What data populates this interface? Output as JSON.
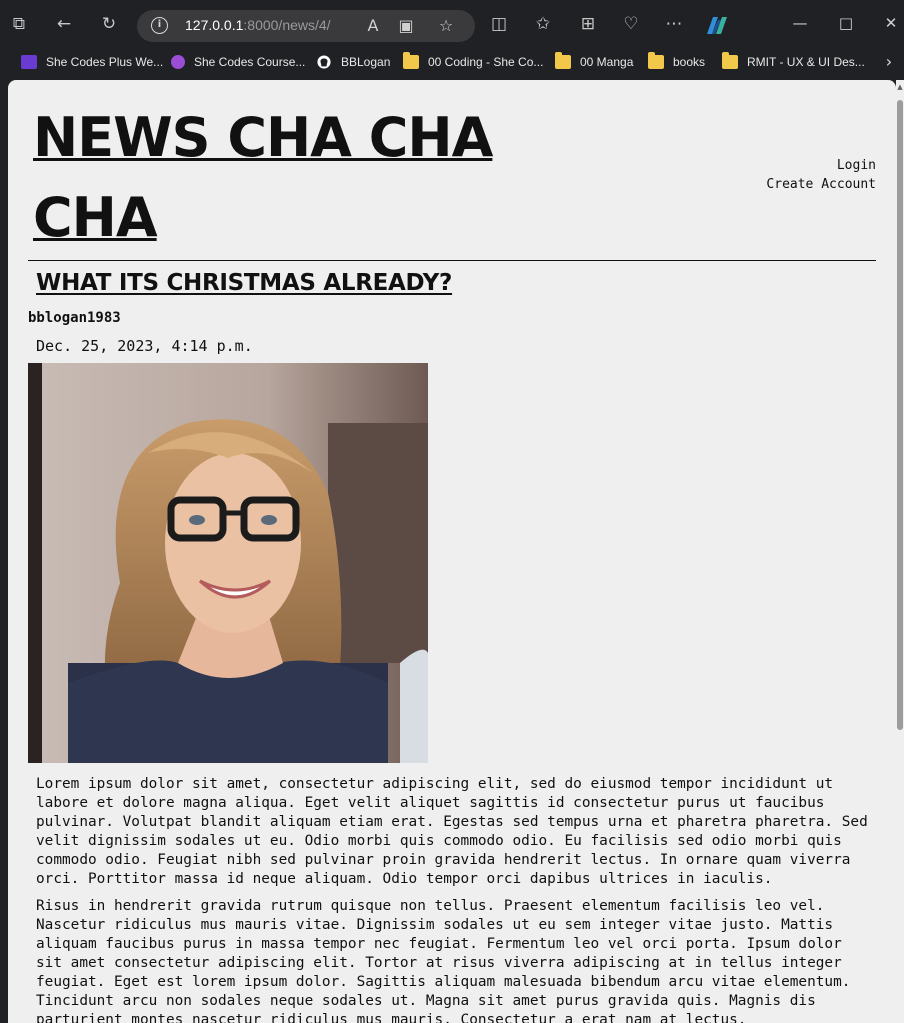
{
  "browser": {
    "url_host": "127.0.0.1",
    "url_path": ":8000/news/4/"
  },
  "bookmarks": [
    {
      "label": "She Codes Plus We...",
      "icon": "list-icon",
      "color": "#6a3bd1"
    },
    {
      "label": "She Codes Course...",
      "icon": "circle-icon",
      "color": "#9b4dd6"
    },
    {
      "label": "BBLogan",
      "icon": "github-icon",
      "color": "#ffffff"
    },
    {
      "label": "00 Coding - She Co...",
      "icon": "folder-icon",
      "color": "#f2c84b"
    },
    {
      "label": "00 Manga",
      "icon": "folder-icon",
      "color": "#f2c84b"
    },
    {
      "label": "books",
      "icon": "folder-icon",
      "color": "#f2c84b"
    },
    {
      "label": "RMIT - UX & UI Des...",
      "icon": "folder-icon",
      "color": "#f2c84b"
    }
  ],
  "site": {
    "title": "NEWS CHA CHA CHA",
    "nav": {
      "login": "Login",
      "create_account": "Create Account"
    }
  },
  "article": {
    "title": "WHAT ITS CHRISTMAS ALREADY?",
    "author": "bblogan1983",
    "date": "Dec. 25, 2023, 4:14 p.m.",
    "paragraphs": [
      "Lorem ipsum dolor sit amet, consectetur adipiscing elit, sed do eiusmod tempor incididunt ut labore et dolore magna aliqua. Eget velit aliquet sagittis id consectetur purus ut faucibus pulvinar. Volutpat blandit aliquam etiam erat. Egestas sed tempus urna et pharetra pharetra. Sed velit dignissim sodales ut eu. Odio morbi quis commodo odio. Eu facilisis sed odio morbi quis commodo odio. Feugiat nibh sed pulvinar proin gravida hendrerit lectus. In ornare quam viverra orci. Porttitor massa id neque aliquam. Odio tempor orci dapibus ultrices in iaculis.",
      "Risus in hendrerit gravida rutrum quisque non tellus. Praesent elementum facilisis leo vel. Nascetur ridiculus mus mauris vitae. Dignissim sodales ut eu sem integer vitae justo. Mattis aliquam faucibus purus in massa tempor nec feugiat. Fermentum leo vel orci porta. Ipsum dolor sit amet consectetur adipiscing elit. Tortor at risus viverra adipiscing at in tellus integer feugiat. Eget est lorem ipsum dolor. Sagittis aliquam malesuada bibendum arcu vitae elementum. Tincidunt arcu non sodales neque sodales ut. Magna sit amet purus gravida quis. Magnis dis parturient montes nascetur ridiculus mus mauris. Consectetur a erat nam at lectus."
    ]
  }
}
